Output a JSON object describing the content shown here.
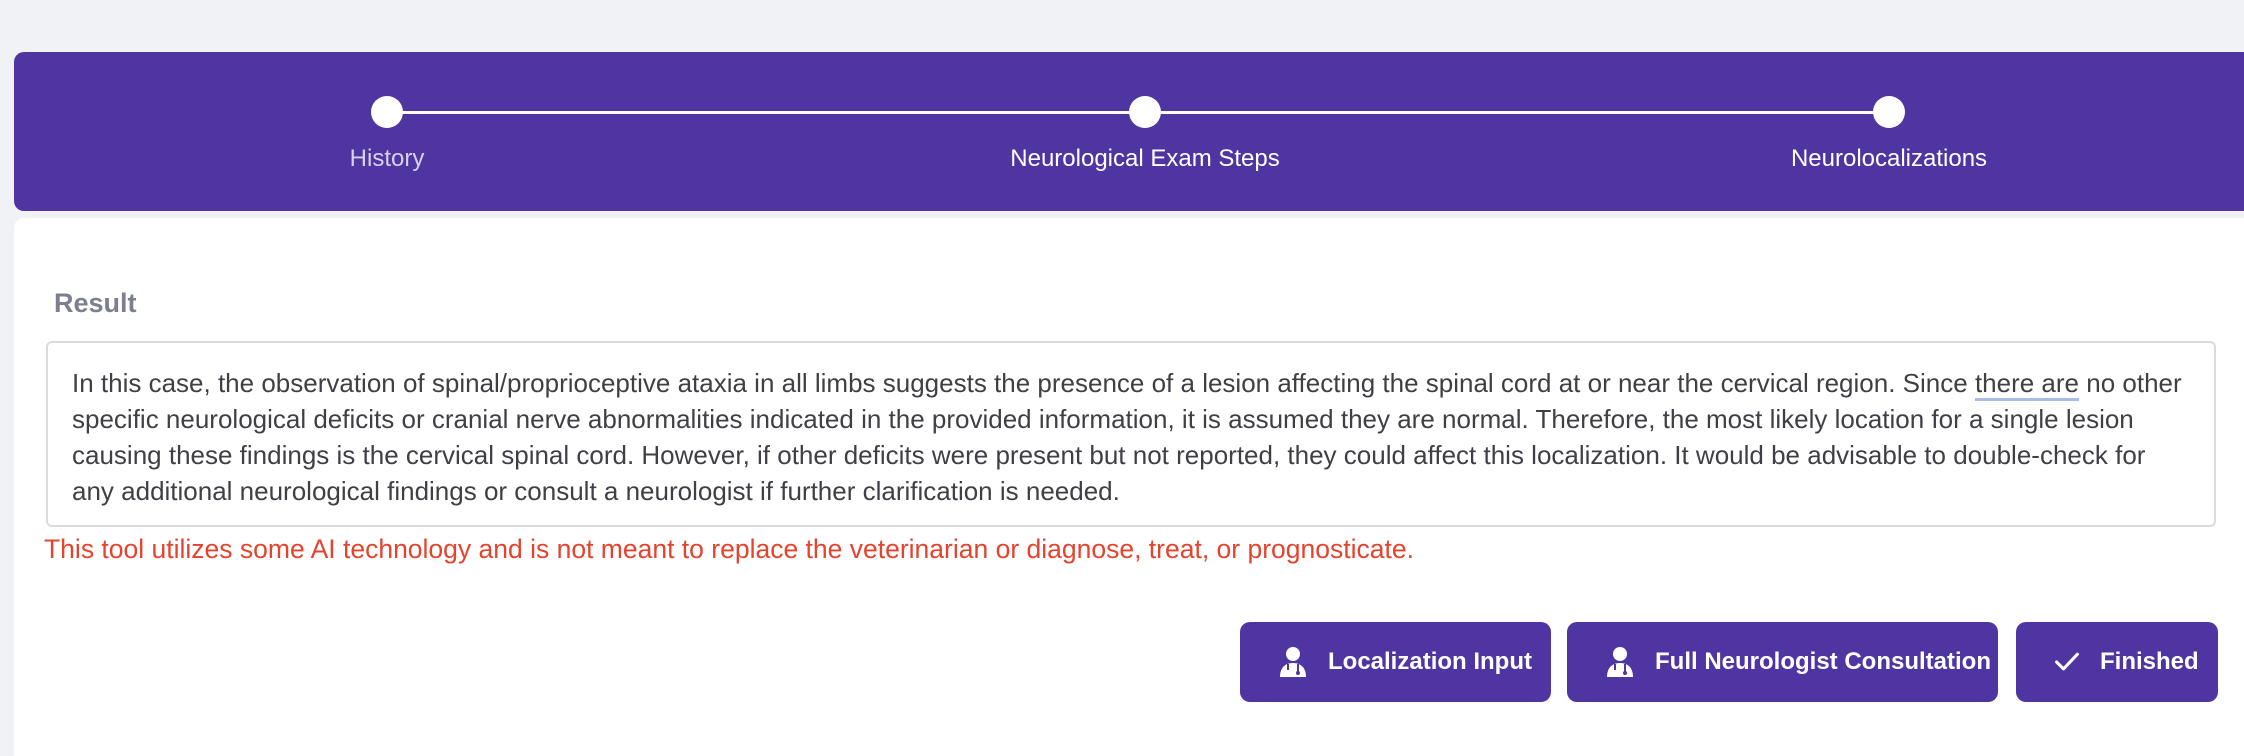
{
  "stepper": {
    "steps": [
      {
        "label": "History"
      },
      {
        "label": "Neurological Exam Steps"
      },
      {
        "label": "Neurolocalizations"
      }
    ]
  },
  "result": {
    "title": "Result",
    "text_part1": "In this case, the observation of spinal/proprioceptive ataxia in all limbs suggests the presence of a lesion affecting the spinal cord at or near the cervical region. Since ",
    "text_underlined": "there are",
    "text_part2": " no other specific neurological deficits or cranial nerve abnormalities indicated in the provided information, it is assumed they are normal. Therefore, the most likely location for a single lesion causing these findings is the cervical spinal cord. However, if other deficits were present but not reported, they could affect this localization. It would be advisable to double-check for any additional neurological findings or consult a neurologist if further clarification is needed."
  },
  "disclaimer": "This tool utilizes some AI technology and is not meant to replace the veterinarian or diagnose, treat, or prognosticate.",
  "actions": {
    "localization_input": {
      "label": "Localization Input",
      "icon": "doctor-icon"
    },
    "full_consultation": {
      "label": "Full Neurologist Consultation",
      "icon": "doctor-icon"
    },
    "finished": {
      "label": "Finished",
      "icon": "check-icon"
    }
  },
  "colors": {
    "primary": "#4f35a1",
    "warning": "#e5432e",
    "muted_text": "#7b7f8f"
  }
}
